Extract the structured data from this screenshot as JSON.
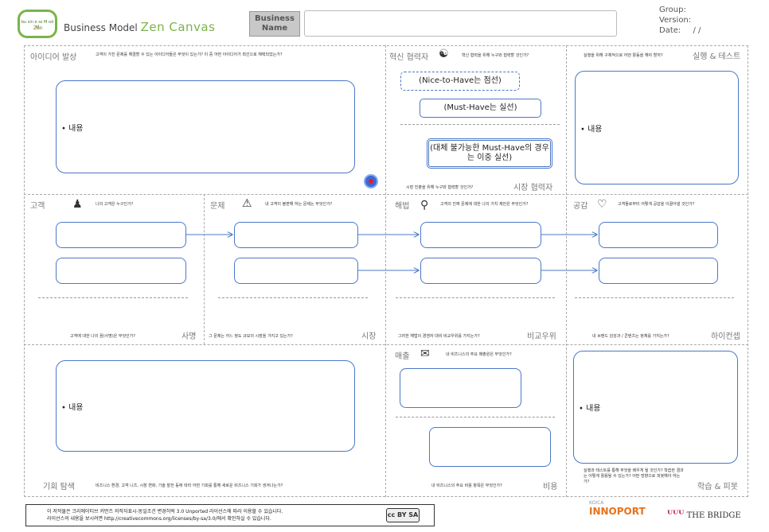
{
  "header": {
    "logo_text": "bu sin e ss M od el",
    "logo_sub": "Zen",
    "title_prefix": "Business Model",
    "title_zen": "Zen Canvas",
    "business_name_label": "Business Name",
    "business_name_value": "",
    "group_label": "Group:",
    "version_label": "Version:",
    "date_label": "Date:",
    "date_value": "/ /"
  },
  "ideation": {
    "title": "아이디어 발상",
    "question": "고객이 가진 문제를 해결할 수 있는 아이디어들은 무엇이 있는가? 이 중 어떤 아이디어가 최선으로 채택되었는가?",
    "bullet": "• 내용"
  },
  "innovation_partner": {
    "title": "혁신 협력자",
    "question": "혁신 협력을 위해 누구와 협력할 것인가?",
    "pill_1": "(Nice-to-Have는 점선)",
    "pill_2": "(Must-Have는 실선)",
    "pill_3": "(대체 불가능한 Must-Have의 경우는 이중 실선)",
    "market_question": "시장 진출을 위해 누구와 협력할 것인가?",
    "market_title": "시장 협력자"
  },
  "execution": {
    "title": "실행 & 테스트",
    "question": "실행을 위해 구체적으로 어떤 활동을 해야 할까?",
    "bullet": "• 내용"
  },
  "customer": {
    "title": "고객",
    "question": "나의 고객은 누구인가?",
    "bottom_question": "고객에 대한 나의 꿈(사명)은 무엇인가?",
    "bottom_title": "사명"
  },
  "problem": {
    "title": "문제",
    "question": "내 고객이 불편해 하는 문제는 무엇인가?",
    "bottom_question": "그 문제는 어느 정도 규모의 시장을 가지고 있는가?",
    "bottom_title": "시장"
  },
  "solution": {
    "title": "해법",
    "question": "고객의 진짜 문제에 대한 나의 가치 제안은 무엇인가?",
    "bottom_question": "그러한 해법이 경쟁자 대비 비교우위를 가지는가?",
    "bottom_title": "비교우위"
  },
  "empathy": {
    "title": "공감",
    "question": "고객들로부터 어떻게 공감을 이끌어낼 것인가?",
    "bottom_question": "내 브랜드 감성과 / 콘텐츠는 정체를 가지는가?",
    "bottom_title": "하이컨셉"
  },
  "opportunity": {
    "title": "기회 탐색",
    "question": "비즈니스 환경, 고객 니즈, 시장 변화, 기술 발전 등에 따라 어떤 기회를 통해 새로운 비즈니스 기회가 생겨나는가?",
    "bullet": "• 내용"
  },
  "revenue": {
    "title": "매출",
    "question": "내 비즈니스의 주요 매출원은 무엇인가?",
    "bottom_question": "내 비즈니스의 주요 비용 항목은 무엇인가?",
    "bottom_title": "비용"
  },
  "learning": {
    "title": "학습 & 피봇",
    "question": "실행과 테스트를 통해 무엇을 배우게 될 것인가? 학습한 결과는 어떻게 활용될 수 있는가? 어떤 방향으로 피봇해야 하는가?",
    "bullet": "• 내용"
  },
  "footer": {
    "license_line_1": "이 저작물은 크리에이티브 커먼즈 저작자표시-동일조건 변경허락 3.0 Unported 라이선스에 따라 이용할 수 있습니다.",
    "license_line_2": "라이선스의 내용을 보시려면 http://creativecommons.org/licenses/by-sa/3.0/에서 확인하실 수 있습니다.",
    "cc_badge": "cc BY SA",
    "koica_label": "KOICA",
    "innoport": "INNOPORT",
    "bridge_label": "THE BRIDGE"
  },
  "colors": {
    "accent_blue": "#4a78c8",
    "zen_green": "#7bb34a",
    "koica_orange": "#e8701a",
    "bridge_red": "#c01a4a"
  }
}
